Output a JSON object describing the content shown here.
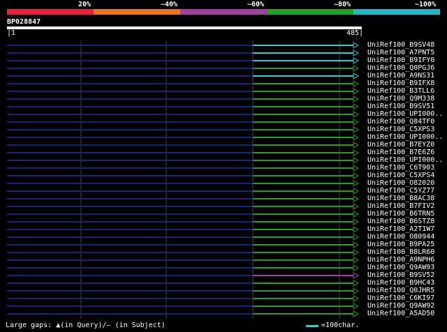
{
  "legend": {
    "labels": [
      "20%",
      "~40%",
      "~60%",
      "~80%",
      "~100%"
    ],
    "colors": [
      "#e8203c",
      "#e87820",
      "#a040a0",
      "#22a022",
      "#22b8c8"
    ]
  },
  "query": {
    "id": "BP028847",
    "start": "1",
    "end": "485"
  },
  "hits": [
    {
      "name": "UniRef100_B9SV48",
      "color": "#33cccc"
    },
    {
      "name": "UniRef100_A7PNT5",
      "color": "#33cccc"
    },
    {
      "name": "UniRef100_B9IFY0",
      "color": "#33cccc"
    },
    {
      "name": "UniRef100_Q0PGJ6",
      "color": "#22a022"
    },
    {
      "name": "UniRef100_A9NS31",
      "color": "#33cccc"
    },
    {
      "name": "UniRef100_B9IFX8",
      "color": "#22a022"
    },
    {
      "name": "UniRef100_B3TLL6",
      "color": "#22a022"
    },
    {
      "name": "UniRef100_Q9M338",
      "color": "#22a022"
    },
    {
      "name": "UniRef100_B9SV51",
      "color": "#22a022"
    },
    {
      "name": "UniRef100_UPI000..",
      "color": "#22a022"
    },
    {
      "name": "UniRef100_Q84TF0",
      "color": "#22a022"
    },
    {
      "name": "UniRef100_C5XPS3",
      "color": "#22a022"
    },
    {
      "name": "UniRef100_UPI000..",
      "color": "#22a022"
    },
    {
      "name": "UniRef100_B7EYZ0",
      "color": "#22a022"
    },
    {
      "name": "UniRef100_B7E6Z6",
      "color": "#22a022"
    },
    {
      "name": "UniRef100_UPI000..",
      "color": "#22a022"
    },
    {
      "name": "UniRef100_C6T903",
      "color": "#22a022"
    },
    {
      "name": "UniRef100_C5XPS4",
      "color": "#22a022"
    },
    {
      "name": "UniRef100_O82020",
      "color": "#22a022"
    },
    {
      "name": "UniRef100_C5YZ77",
      "color": "#22a022"
    },
    {
      "name": "UniRef100_B8AC38",
      "color": "#22a022"
    },
    {
      "name": "UniRef100_B7FIV2",
      "color": "#22a022"
    },
    {
      "name": "UniRef100_B6TRN5",
      "color": "#22a022"
    },
    {
      "name": "UniRef100_B6STZ8",
      "color": "#22a022"
    },
    {
      "name": "UniRef100_A2T1W7",
      "color": "#22a022"
    },
    {
      "name": "UniRef100_O80944",
      "color": "#22a022"
    },
    {
      "name": "UniRef100_B9PA25",
      "color": "#22a022"
    },
    {
      "name": "UniRef100_B8LR60",
      "color": "#22a022"
    },
    {
      "name": "UniRef100_A9NPH6",
      "color": "#22a022"
    },
    {
      "name": "UniRef100_Q9AW93",
      "color": "#22a022"
    },
    {
      "name": "UniRef100_B9SV52",
      "color": "#a040a0"
    },
    {
      "name": "UniRef100_B9HC43",
      "color": "#22a022"
    },
    {
      "name": "UniRef100_Q0JHR5",
      "color": "#22a022"
    },
    {
      "name": "UniRef100_C6KI97",
      "color": "#22a022"
    },
    {
      "name": "UniRef100_Q9AW92",
      "color": "#22a022"
    },
    {
      "name": "UniRef100_A5AD50",
      "color": "#22a022"
    }
  ],
  "footer": {
    "gaps_label": "Large gaps: ▲(in Query)/– (in Subject)",
    "scale_label": "=100char."
  }
}
